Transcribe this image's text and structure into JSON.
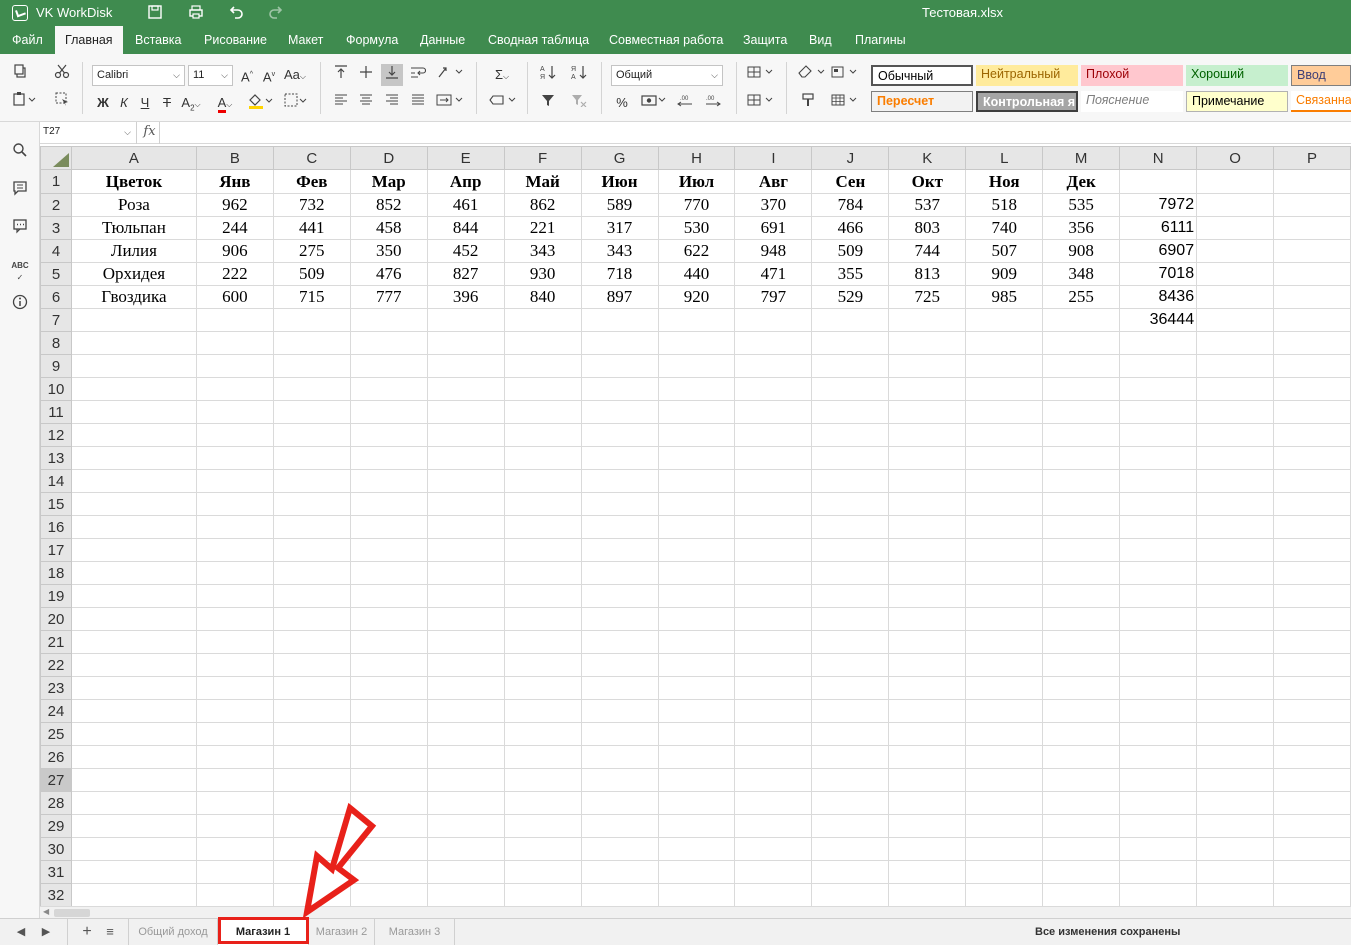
{
  "app": {
    "name": "VK WorkDisk",
    "document": "Тестовая.xlsx"
  },
  "menu": {
    "tabs": [
      {
        "label": "Файл"
      },
      {
        "label": "Главная"
      },
      {
        "label": "Вставка"
      },
      {
        "label": "Рисование"
      },
      {
        "label": "Макет"
      },
      {
        "label": "Формула"
      },
      {
        "label": "Данные"
      },
      {
        "label": "Сводная таблица"
      },
      {
        "label": "Совместная работа"
      },
      {
        "label": "Защита"
      },
      {
        "label": "Вид"
      },
      {
        "label": "Плагины"
      }
    ],
    "active": "Главная"
  },
  "ribbon": {
    "font_name": "Calibri",
    "font_size": "11",
    "number_format": "Общий",
    "styles": [
      {
        "label": "Обычный",
        "color": "#000000",
        "bg": "#ffffff"
      },
      {
        "label": "Нейтральный",
        "color": "#9c6500",
        "bg": "#ffeb9c"
      },
      {
        "label": "Плохой",
        "color": "#9c0006",
        "bg": "#ffc7ce"
      },
      {
        "label": "Хороший",
        "color": "#006100",
        "bg": "#c6efce"
      },
      {
        "label": "Ввод",
        "color": "#3f3f76",
        "bg": "#ffcc99"
      },
      {
        "label": "Пересчет",
        "color": "#fa7d00",
        "bg": "#f2f2f2"
      },
      {
        "label": "Контрольная я",
        "color": "#ffffff",
        "bg": "#a5a5a5"
      },
      {
        "label": "Пояснение",
        "color": "#7f7f7f",
        "bg": "#ffffff"
      },
      {
        "label": "Примечание",
        "color": "#000000",
        "bg": "#ffffcc"
      },
      {
        "label": "Связанна",
        "color": "#fa7d00",
        "bg": "#ffffff"
      }
    ]
  },
  "formula_bar": {
    "cell_ref": "T27",
    "fx": "fx",
    "value": ""
  },
  "grid": {
    "columns": [
      "A",
      "B",
      "C",
      "D",
      "E",
      "F",
      "G",
      "H",
      "I",
      "J",
      "K",
      "L",
      "M",
      "N",
      "O",
      "P"
    ],
    "selected_row": 27,
    "header_row": [
      "Цветок",
      "Янв",
      "Фев",
      "Мар",
      "Апр",
      "Май",
      "Июн",
      "Июл",
      "Авг",
      "Сен",
      "Окт",
      "Ноя",
      "Дек"
    ],
    "rows": [
      {
        "name": "Роза",
        "values": [
          "962",
          "732",
          "852",
          "461",
          "862",
          "589",
          "770",
          "370",
          "784",
          "537",
          "518",
          "535"
        ],
        "total": "7972"
      },
      {
        "name": "Тюльпан",
        "values": [
          "244",
          "441",
          "458",
          "844",
          "221",
          "317",
          "530",
          "691",
          "466",
          "803",
          "740",
          "356"
        ],
        "total": "6111"
      },
      {
        "name": "Лилия",
        "values": [
          "906",
          "275",
          "350",
          "452",
          "343",
          "343",
          "622",
          "948",
          "509",
          "744",
          "507",
          "908"
        ],
        "total": "6907"
      },
      {
        "name": "Орхидея",
        "values": [
          "222",
          "509",
          "476",
          "827",
          "930",
          "718",
          "440",
          "471",
          "355",
          "813",
          "909",
          "348"
        ],
        "total": "7018"
      },
      {
        "name": "Гвоздика",
        "values": [
          "600",
          "715",
          "777",
          "396",
          "840",
          "897",
          "920",
          "797",
          "529",
          "725",
          "985",
          "255"
        ],
        "total": "8436"
      }
    ],
    "grand_total": "36444"
  },
  "sheets": {
    "tabs": [
      {
        "label": "Общий доход"
      },
      {
        "label": "Магазин 1"
      },
      {
        "label": "Магазин 2"
      },
      {
        "label": "Магазин 3"
      }
    ],
    "active": "Магазин 1"
  },
  "status": {
    "text": "Все изменения сохранены"
  },
  "annotation": {
    "highlight_color": "#e8211a"
  }
}
